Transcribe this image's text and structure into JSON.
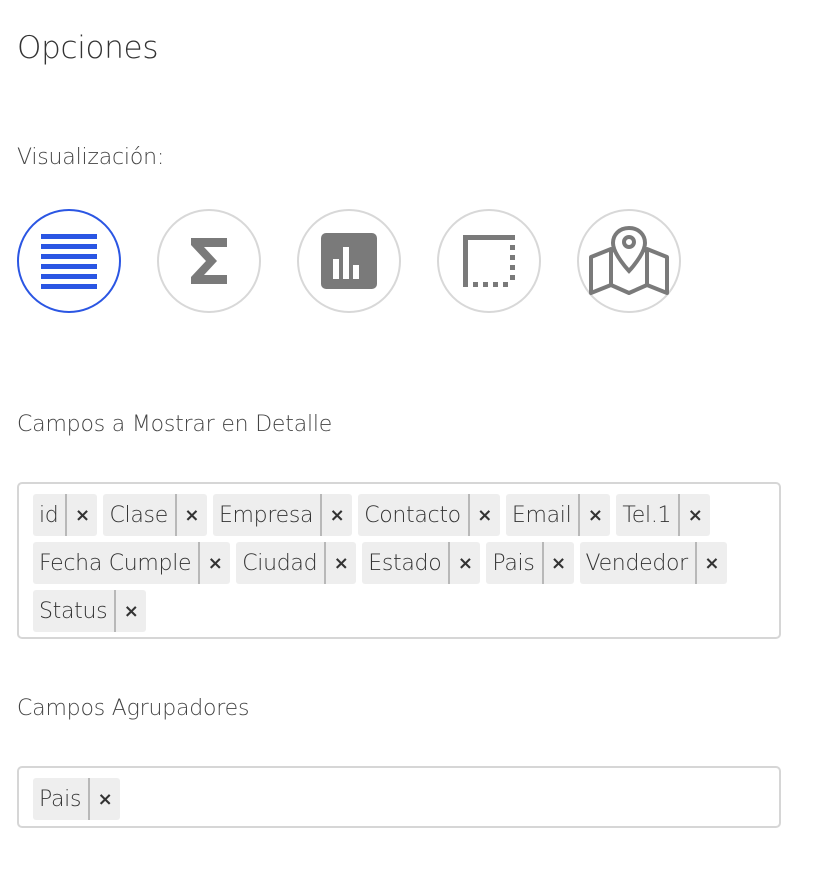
{
  "title": "Opciones",
  "visualization": {
    "label": "Visualización:",
    "active_color": "#2b56e3",
    "icon_color": "#7a7a7a",
    "options": [
      {
        "icon": "list-icon",
        "active": true
      },
      {
        "icon": "sigma-icon",
        "active": false
      },
      {
        "icon": "bar-chart-icon",
        "active": false
      },
      {
        "icon": "pivot-table-icon",
        "active": false
      },
      {
        "icon": "map-icon",
        "active": false
      }
    ]
  },
  "detail_fields": {
    "label": "Campos a Mostrar en Detalle",
    "remove_glyph": "×",
    "tags": [
      "id",
      "Clase",
      "Empresa",
      "Contacto",
      "Email",
      "Tel.1",
      "Fecha Cumple",
      "Ciudad",
      "Estado",
      "Pais",
      "Vendedor",
      "Status"
    ]
  },
  "group_fields": {
    "label": "Campos Agrupadores",
    "remove_glyph": "×",
    "tags": [
      "Pais"
    ]
  }
}
